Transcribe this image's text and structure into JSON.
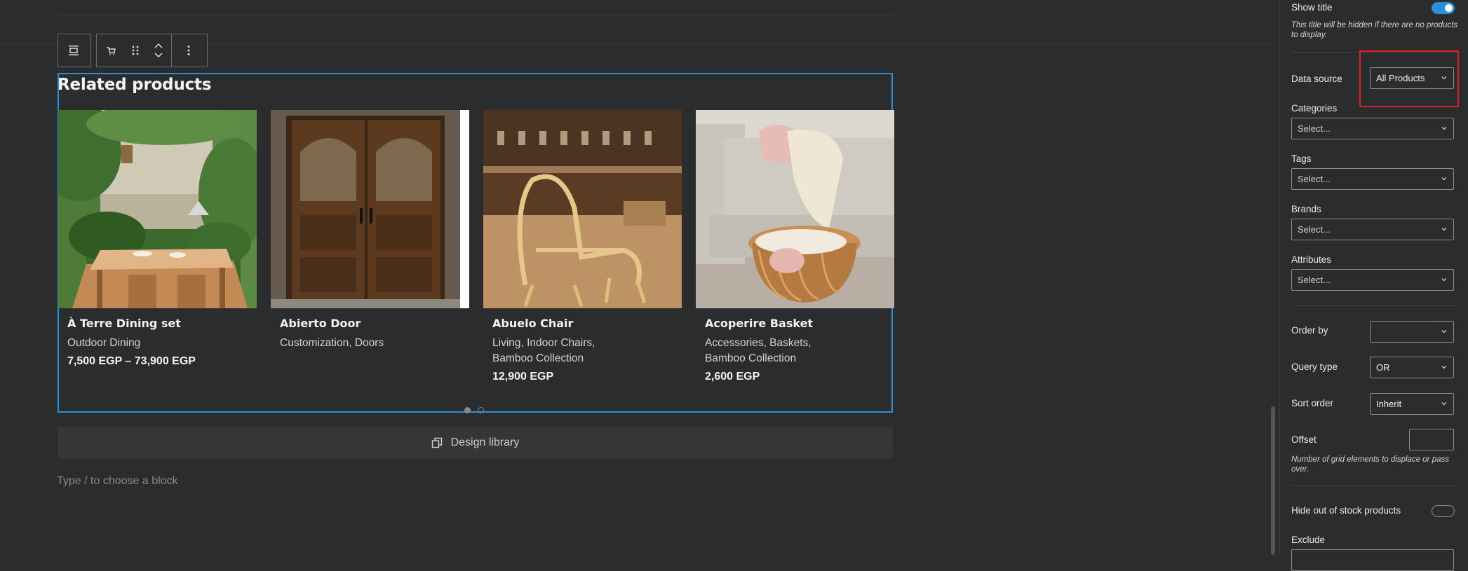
{
  "block": {
    "title": "Related products",
    "products": [
      {
        "name": "À Terre Dining set",
        "categories": "Outdoor Dining",
        "price": "7,500 EGP – 73,900 EGP"
      },
      {
        "name": "Abierto Door",
        "categories": "Customization, Doors",
        "price": ""
      },
      {
        "name": "Abuelo Chair",
        "categories": "Living, Indoor Chairs, Bamboo Collection",
        "price": "12,900 EGP"
      },
      {
        "name": "Acoperire Basket",
        "categories": "Accessories, Baskets, Bamboo Collection",
        "price": "2,600 EGP"
      }
    ]
  },
  "design_library": {
    "label": "Design library"
  },
  "placeholder": {
    "text": "Type / to choose a block"
  },
  "sidebar": {
    "show_title": {
      "label": "Show title",
      "help": "This title will be hidden if there are no products to display.",
      "enabled": true
    },
    "data_source": {
      "label": "Data source",
      "value": "All Products"
    },
    "categories": {
      "label": "Categories",
      "value": "Select..."
    },
    "tags": {
      "label": "Tags",
      "value": "Select..."
    },
    "brands": {
      "label": "Brands",
      "value": "Select..."
    },
    "attributes": {
      "label": "Attributes",
      "value": "Select..."
    },
    "order_by": {
      "label": "Order by",
      "value": ""
    },
    "query_type": {
      "label": "Query type",
      "value": "OR"
    },
    "sort_order": {
      "label": "Sort order",
      "value": "Inherit"
    },
    "offset": {
      "label": "Offset",
      "value": "",
      "help": "Number of grid elements to displace or pass over."
    },
    "hide_out_of_stock": {
      "label": "Hide out of stock products",
      "enabled": false
    },
    "exclude": {
      "label": "Exclude"
    }
  },
  "colors": {
    "accent": "#2a8fd6",
    "highlight": "#e02020"
  }
}
